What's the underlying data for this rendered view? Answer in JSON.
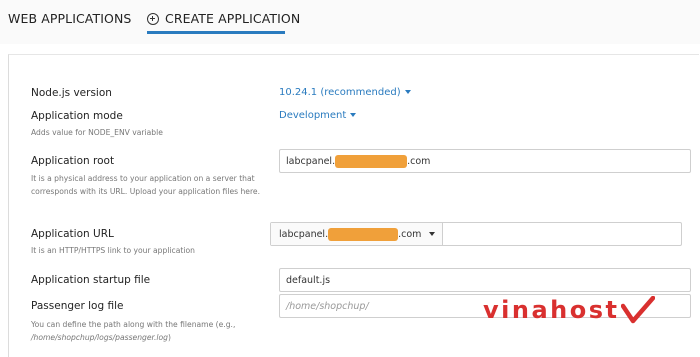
{
  "tabs": {
    "web_applications": "WEB APPLICATIONS",
    "create_application": "CREATE APPLICATION"
  },
  "form": {
    "node_version": {
      "label": "Node.js version",
      "value": "10.24.1 (recommended)"
    },
    "app_mode": {
      "label": "Application mode",
      "help": "Adds value for NODE_ENV variable",
      "value": "Development"
    },
    "app_root": {
      "label": "Application root",
      "help": "It is a physical address to your application on a server that corresponds with its URL. Upload your application files here.",
      "value_prefix": "labcpanel.",
      "value_suffix": ".com"
    },
    "app_url": {
      "label": "Application URL",
      "help": "It is an HTTP/HTTPS link to your application",
      "value_prefix": "labcpanel.",
      "value_suffix": ".com"
    },
    "startup_file": {
      "label": "Application startup file",
      "value": "default.js"
    },
    "passenger_log": {
      "label": "Passenger log file",
      "placeholder": "/home/shopchup/",
      "help_prefix": "You can define the path along with the filename (e.g.,",
      "help_example": "/home/shopchup/logs/passenger.log",
      "help_suffix": ")"
    }
  },
  "watermark": {
    "text": "vinahost"
  }
}
